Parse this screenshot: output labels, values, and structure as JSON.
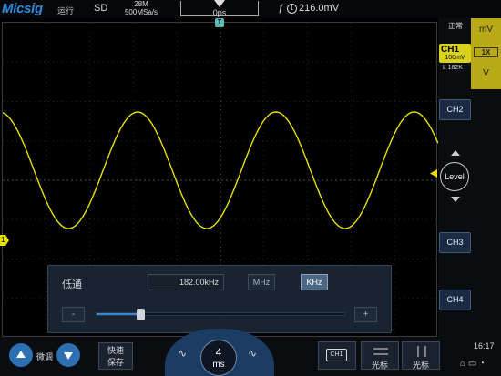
{
  "header": {
    "logo": "Micsig",
    "run_status": "运行",
    "acq_mode": "SD",
    "memory_depth": "28M",
    "sample_rate": "500MSa/s",
    "trigger_position": "0ps",
    "trigger_source": "1",
    "trigger_level": "216.0mV"
  },
  "right_panel": {
    "status": "正常",
    "ch1_label": "CH1",
    "ch1_scale": "100mV",
    "ch1_bandwidth": "L 182K",
    "unit_mv": "mV",
    "probe": "1X",
    "unit_v": "V",
    "ch2": "CH2",
    "ch3": "CH3",
    "ch4": "CH4",
    "level": "Level",
    "time": "16:17"
  },
  "waveform": {
    "channel_marker": "1",
    "color": "#e8e000",
    "periods_on_screen": 3.15
  },
  "filter_panel": {
    "title": "低通",
    "value": "182.00kHz",
    "unit_mhz": "MHz",
    "unit_khz": "KHz",
    "minus": "-",
    "plus": "+",
    "slider_level": 0.18
  },
  "bottom_bar": {
    "fine_label": "微调",
    "quick_save_line1": "快速",
    "quick_save_line2": "保存",
    "timebase_value": "4",
    "timebase_unit": "ms",
    "ch1_button": "CH1",
    "cursor1_label": "光标",
    "cursor2_label": "光标"
  },
  "colors": {
    "accent": "#2f8cd8",
    "ch1": "#d8d21a",
    "panel": "#1c2634"
  }
}
